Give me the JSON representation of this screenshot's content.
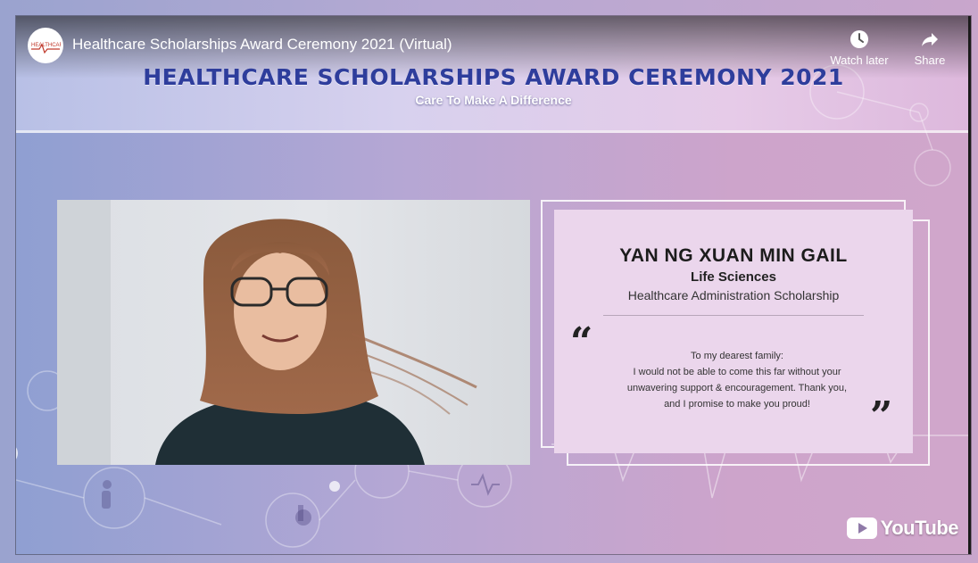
{
  "player": {
    "video_title": "Healthcare Scholarships Award Ceremony 2021 (Virtual)",
    "channel_avatar_icon": "healthcare-scholarships-logo-icon",
    "watch_later_label": "Watch later",
    "watch_later_icon": "clock-icon",
    "share_label": "Share",
    "share_icon": "share-arrow-icon",
    "youtube_logo_text": "YouTube",
    "youtube_logo_icon": "youtube-play-icon"
  },
  "banner": {
    "title": "HEALTHCARE SCHOLARSHIPS AWARD CEREMONY 2021",
    "subtitle": "Care To Make A Difference"
  },
  "card": {
    "name": "YAN NG XUAN MIN GAIL",
    "faculty": "Life Sciences",
    "scholarship": "Healthcare Administration Scholarship",
    "quote_open": "“",
    "quote_close": "”",
    "quote_lines": [
      "To my dearest family:",
      "I would not be able to come this far without your",
      "unwavering support & encouragement. Thank you,",
      "and I promise to make you proud!"
    ]
  },
  "colors": {
    "title_blue": "#2e3d9c",
    "card_bg": "#ebd6ec",
    "youtube_red": "#ff0000"
  }
}
